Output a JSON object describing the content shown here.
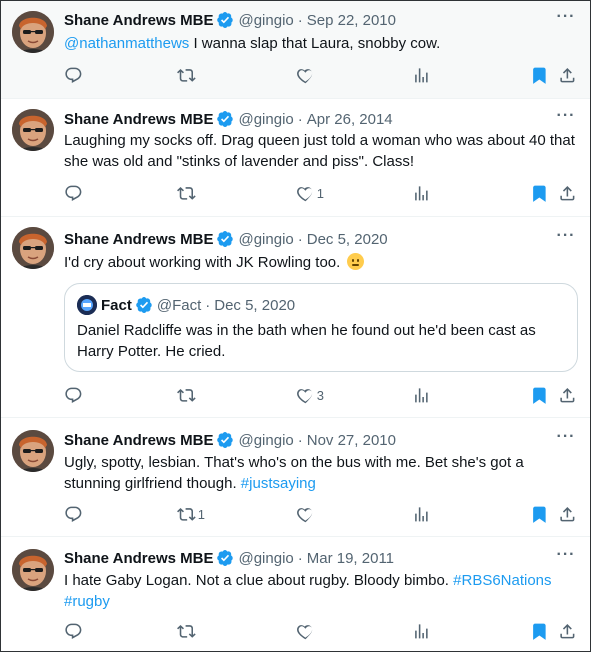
{
  "colors": {
    "accent": "#1d9bf0",
    "secondary_text": "#536471",
    "primary_text": "#0f1419",
    "border": "#cfd9de"
  },
  "tweets": [
    {
      "name": "Shane Andrews MBE",
      "handle": "@gingio",
      "date": "Sep 22, 2010",
      "mention": "@nathanmatthews",
      "text": " I wanna slap that Laura, snobby cow.",
      "reply_count": "",
      "retweet_count": "",
      "like_count": ""
    },
    {
      "name": "Shane Andrews MBE",
      "handle": "@gingio",
      "date": "Apr 26, 2014",
      "text": "Laughing my socks off. Drag queen just told a woman who was about 40 that she was old and \"stinks of lavender and piss\".  Class!",
      "reply_count": "",
      "retweet_count": "",
      "like_count": "1"
    },
    {
      "name": "Shane Andrews MBE",
      "handle": "@gingio",
      "date": "Dec 5, 2020",
      "text": "I'd cry about working with JK Rowling too. ",
      "emoji": "neutral-face-emoji",
      "quote": {
        "name": "Fact",
        "handle": "@Fact",
        "date": "Dec 5, 2020",
        "text": "Daniel Radcliffe was in the bath when he found out he'd been cast as Harry Potter. He cried."
      },
      "reply_count": "",
      "retweet_count": "",
      "like_count": "3"
    },
    {
      "name": "Shane Andrews MBE",
      "handle": "@gingio",
      "date": "Nov 27, 2010",
      "text": "Ugly, spotty, lesbian.  That's who's on the bus with me.  Bet she's got a stunning girlfriend though. ",
      "hashtag": "#justsaying",
      "reply_count": "",
      "retweet_count": "1",
      "like_count": ""
    },
    {
      "name": "Shane Andrews MBE",
      "handle": "@gingio",
      "date": "Mar 19, 2011",
      "text": "I hate Gaby Logan. Not a clue about rugby. Bloody bimbo. ",
      "hashtag": "#RBS6Nations",
      "hashtag2": "#rugby",
      "reply_count": "",
      "retweet_count": "",
      "like_count": ""
    }
  ],
  "icons": [
    "avatar",
    "verified-badge-icon",
    "more-icon",
    "reply-icon",
    "retweet-icon",
    "like-icon",
    "views-icon",
    "bookmark-icon",
    "share-icon"
  ]
}
